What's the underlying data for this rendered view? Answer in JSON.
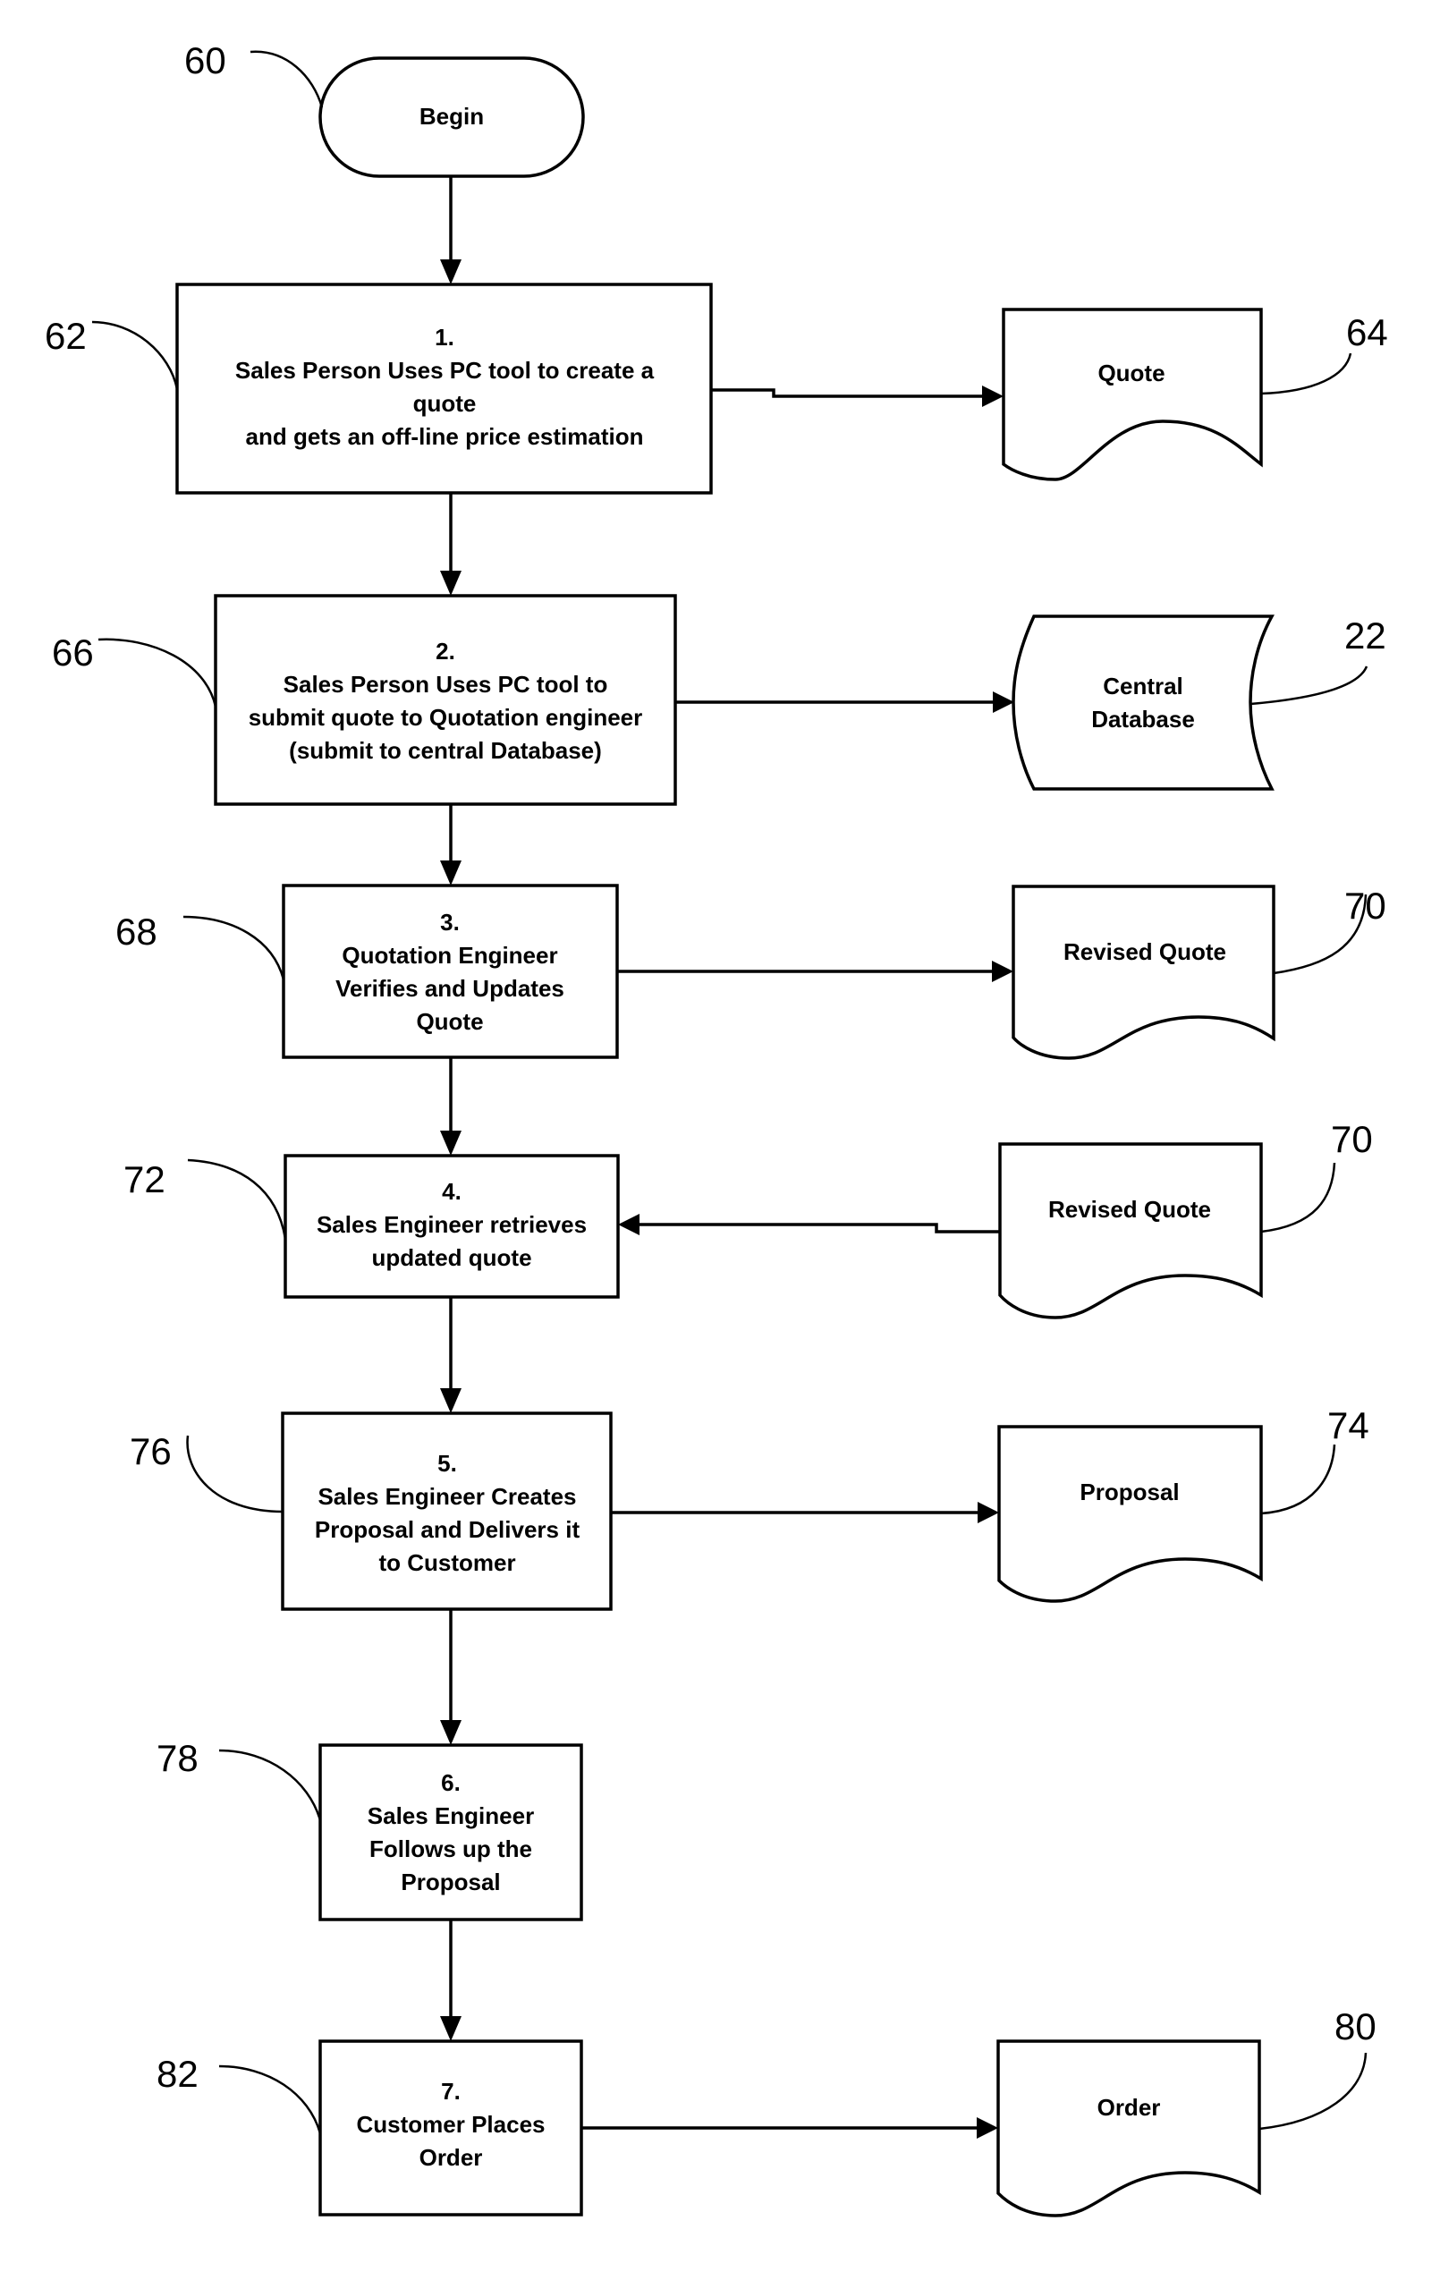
{
  "figure": {
    "start": {
      "label": "Begin",
      "ref": "60"
    },
    "steps": [
      {
        "ref": "62",
        "number": "1.",
        "lines": [
          "Sales Person Uses PC tool to create a",
          "quote",
          "and gets an off-line price estimation"
        ]
      },
      {
        "ref": "66",
        "number": "2.",
        "lines": [
          "Sales Person Uses PC tool to",
          "submit quote to Quotation engineer",
          "(submit to central Database)"
        ]
      },
      {
        "ref": "68",
        "number": "3.",
        "lines": [
          "Quotation Engineer",
          "Verifies and Updates",
          "Quote"
        ]
      },
      {
        "ref": "72",
        "number": "4.",
        "lines": [
          "Sales Engineer retrieves",
          "updated quote"
        ]
      },
      {
        "ref": "76",
        "number": "5.",
        "lines": [
          "Sales Engineer Creates",
          "Proposal and Delivers it",
          "to Customer"
        ]
      },
      {
        "ref": "78",
        "number": "6.",
        "lines": [
          "Sales Engineer",
          "Follows up the",
          "Proposal"
        ]
      },
      {
        "ref": "82",
        "number": "7.",
        "lines": [
          "Customer Places",
          "Order"
        ]
      }
    ],
    "outputs": [
      {
        "ref": "64",
        "lines": [
          "Quote"
        ],
        "kind": "document"
      },
      {
        "ref": "22",
        "lines": [
          "Central",
          "Database"
        ],
        "kind": "stored-data"
      },
      {
        "ref": "70",
        "lines": [
          "Revised Quote"
        ],
        "kind": "document"
      },
      {
        "ref": "70",
        "lines": [
          "Revised Quote"
        ],
        "kind": "document"
      },
      {
        "ref": "74",
        "lines": [
          "Proposal"
        ],
        "kind": "document"
      },
      {
        "ref": "80",
        "lines": [
          "Order"
        ],
        "kind": "document"
      }
    ]
  }
}
